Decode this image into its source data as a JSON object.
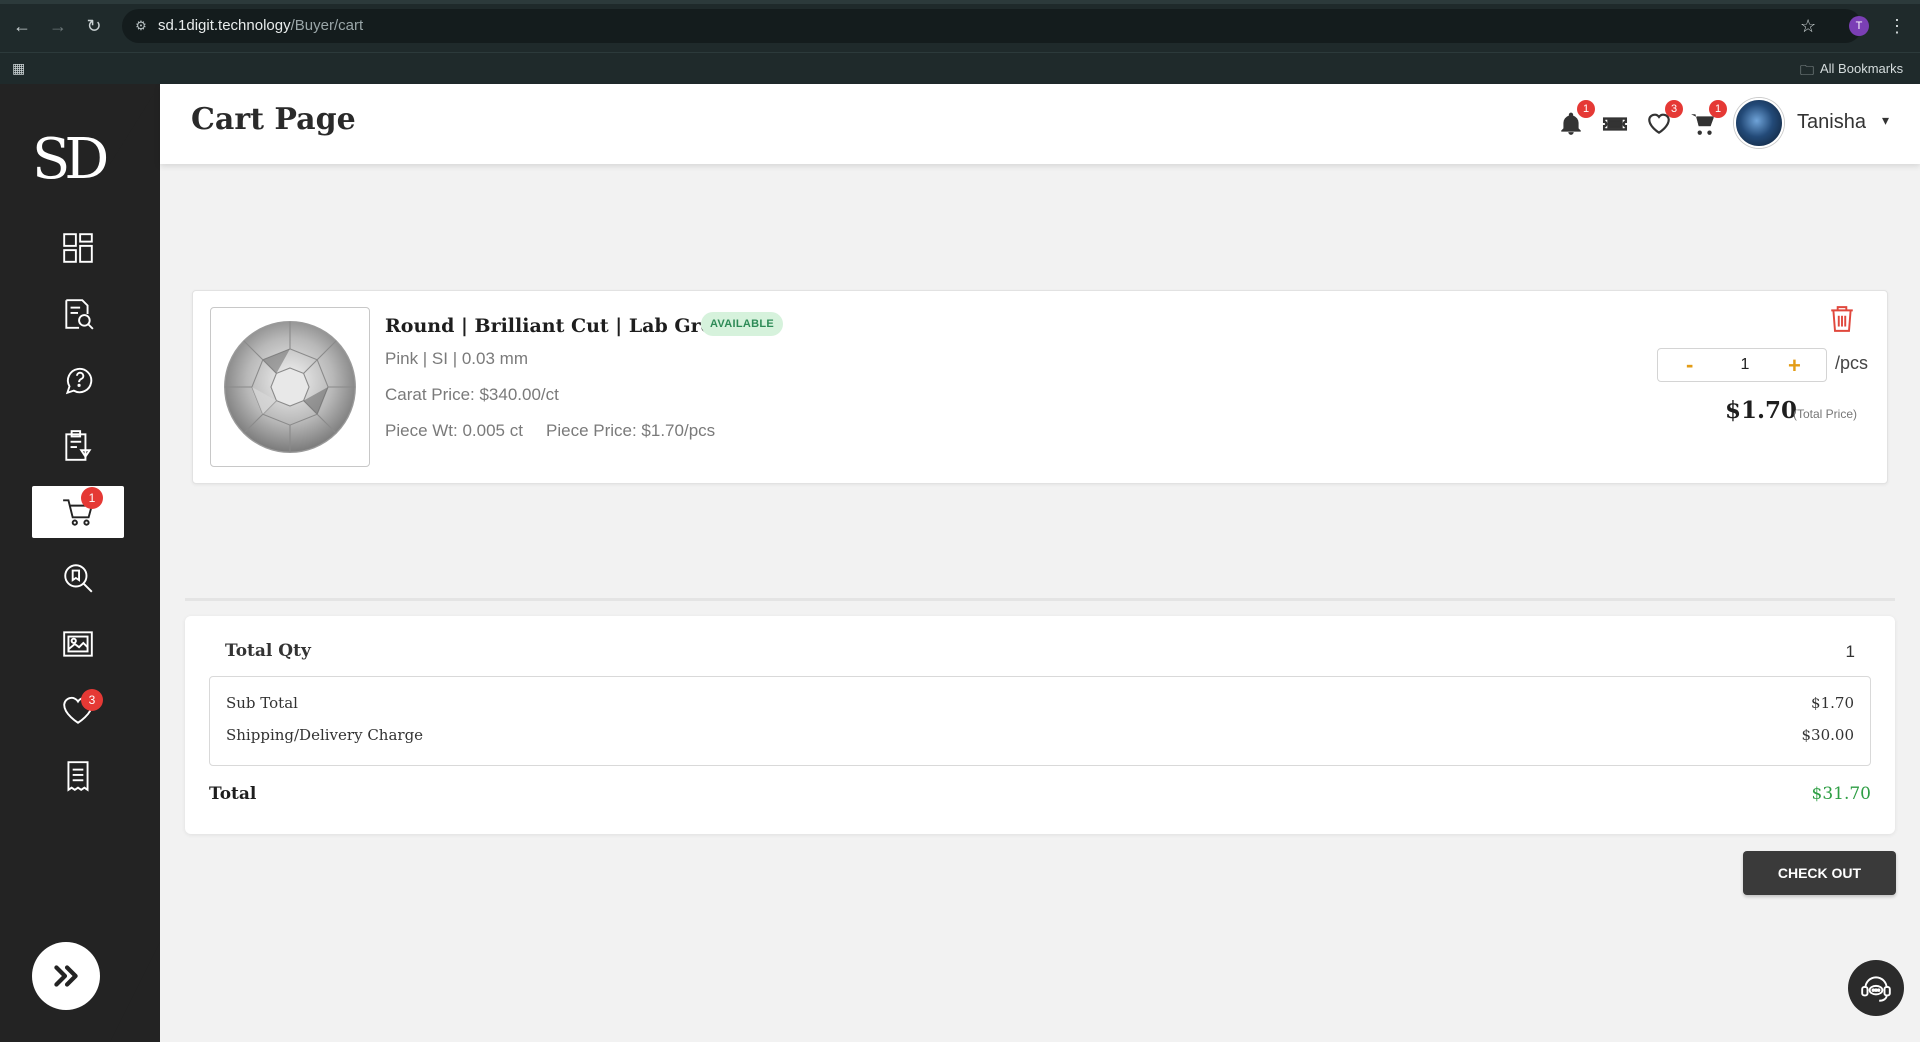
{
  "browser": {
    "url_host": "sd.1digit.technology",
    "url_path": "/Buyer/cart",
    "profile_initial": "T",
    "bookmarks_label": "All Bookmarks"
  },
  "sidebar": {
    "logo_text": "SD",
    "cart_badge": "1",
    "wishlist_badge": "3"
  },
  "header": {
    "title": "Cart Page",
    "notifications_badge": "1",
    "wishlist_badge": "3",
    "cart_badge": "1",
    "user_name": "Tanisha"
  },
  "cart_item": {
    "title": "Round | Brilliant Cut | Lab Grown",
    "status": "AVAILABLE",
    "spec": "Pink | SI | 0.03 mm",
    "carat_price": "Carat Price: $340.00/ct",
    "piece_wt": "Piece Wt: 0.005 ct",
    "piece_price": "Piece Price: $1.70/pcs",
    "qty_minus": "-",
    "qty": "1",
    "qty_plus": "+",
    "unit": "/pcs",
    "total_price": "$1.70",
    "total_price_label": "(Total Price)"
  },
  "summary": {
    "total_qty_label": "Total Qty",
    "total_qty": "1",
    "sub_total_label": "Sub Total",
    "sub_total": "$1.70",
    "shipping_label": "Shipping/Delivery Charge",
    "shipping": "$30.00",
    "total_label": "Total",
    "total": "$31.70"
  },
  "checkout_label": "CHECK OUT",
  "colors": {
    "sidebar_bg": "#232323",
    "badge_red": "#e53935",
    "accent_orange": "#e39c16",
    "total_green": "#2e9e44",
    "available_green": "#2e8b57"
  }
}
